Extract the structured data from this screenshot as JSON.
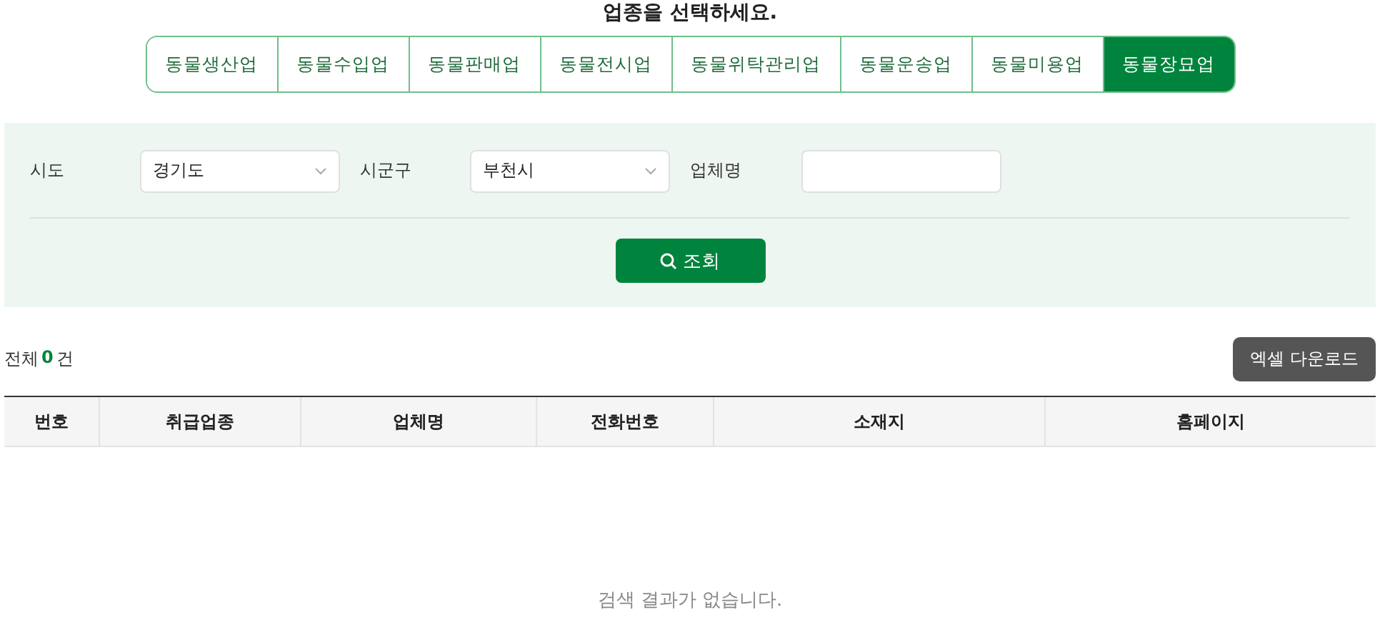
{
  "title": "업종을 선택하세요.",
  "tabs": [
    {
      "label": "동물생산업",
      "selected": false
    },
    {
      "label": "동물수입업",
      "selected": false
    },
    {
      "label": "동물판매업",
      "selected": false
    },
    {
      "label": "동물전시업",
      "selected": false
    },
    {
      "label": "동물위탁관리업",
      "selected": false
    },
    {
      "label": "동물운송업",
      "selected": false
    },
    {
      "label": "동물미용업",
      "selected": false
    },
    {
      "label": "동물장묘업",
      "selected": true
    }
  ],
  "filters": [
    {
      "kind": "select",
      "label": "시도",
      "value": "경기도"
    },
    {
      "kind": "select",
      "label": "시군구",
      "value": "부천시"
    },
    {
      "kind": "input",
      "label": "업체명"
    }
  ],
  "search_button": "조회",
  "total": {
    "prefix": "전체",
    "count": "0",
    "suffix": "건"
  },
  "excel_button": "엑셀 다운로드",
  "table": {
    "columns": [
      "번호",
      "취급업종",
      "업체명",
      "전화번호",
      "소재지",
      "홈페이지"
    ],
    "empty_message": "검색 결과가 없습니다."
  }
}
